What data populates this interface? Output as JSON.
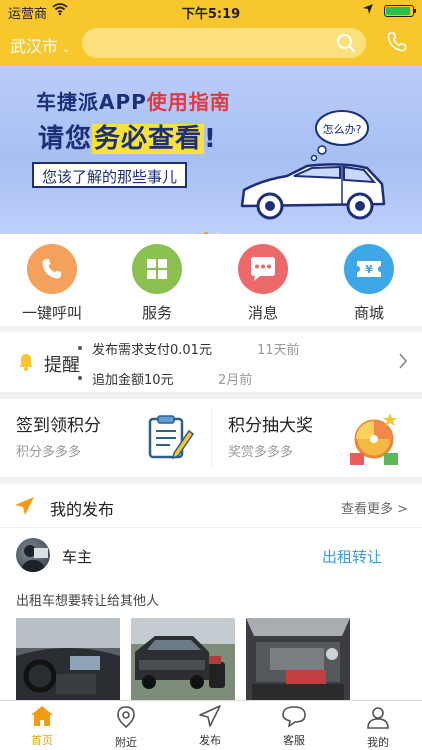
{
  "status_bar": {
    "carrier": "运营商",
    "time": "下午5:19"
  },
  "header": {
    "city": "武汉市",
    "search_placeholder": ""
  },
  "banner": {
    "line1_prefix": "车捷派APP",
    "line1_highlight": "使用指南",
    "line2_prefix": "请您",
    "line2_highlight": "务必查看",
    "line2_suffix": "!",
    "line3": "您该了解的那些事儿",
    "bubble": "怎么办?",
    "active_dot": 0
  },
  "quick_actions": [
    {
      "label": "一键呼叫",
      "icon": "phone-icon",
      "color": "#f4a15d"
    },
    {
      "label": "服务",
      "icon": "grid-icon",
      "color": "#8cc152"
    },
    {
      "label": "消息",
      "icon": "chat-icon",
      "color": "#ed6969"
    },
    {
      "label": "商城",
      "icon": "ticket-icon",
      "color": "#3ea7e8"
    }
  ],
  "reminder": {
    "title": "提醒",
    "items": [
      {
        "text": "发布需求支付0.01元",
        "time": "11天前"
      },
      {
        "text": "追加金额10元",
        "time": "2月前"
      }
    ]
  },
  "points": {
    "left": {
      "title": "签到领积分",
      "subtitle": "积分多多多"
    },
    "right": {
      "title": "积分抽大奖",
      "subtitle": "奖赏多多多"
    }
  },
  "publish": {
    "title": "我的发布",
    "more": "查看更多 >",
    "post": {
      "user": "车主",
      "tag": "出租转让",
      "description": "出租车想要转让给其他人"
    }
  },
  "tabbar": [
    {
      "label": "首页",
      "icon": "home-icon",
      "active": true
    },
    {
      "label": "附近",
      "icon": "location-icon",
      "active": false
    },
    {
      "label": "发布",
      "icon": "send-icon",
      "active": false
    },
    {
      "label": "客服",
      "icon": "message-icon",
      "active": false
    },
    {
      "label": "我的",
      "icon": "user-icon",
      "active": false
    }
  ],
  "colors": {
    "brand_yellow": "#f7c72c",
    "active_tab": "#f39c12",
    "link_blue": "#3a9ce8"
  }
}
